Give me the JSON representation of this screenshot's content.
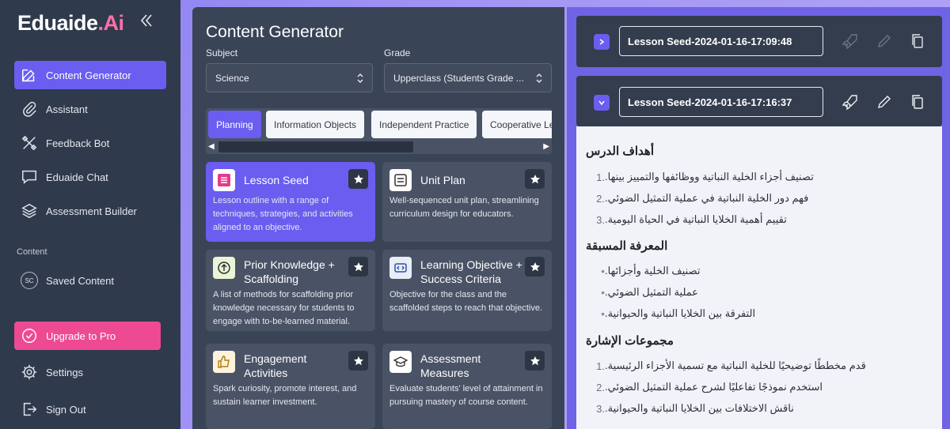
{
  "app": {
    "logo_main": "Eduaide",
    "logo_accent": ".Ai"
  },
  "sidebar": {
    "items": [
      {
        "label": "Content Generator"
      },
      {
        "label": "Assistant"
      },
      {
        "label": "Feedback Bot"
      },
      {
        "label": "Eduaide Chat"
      },
      {
        "label": "Assessment Builder"
      }
    ],
    "section_label": "Content",
    "saved": {
      "badge": "SC",
      "label": "Saved Content"
    },
    "upgrade": "Upgrade to Pro",
    "settings": "Settings",
    "signout": "Sign Out"
  },
  "generator": {
    "title": "Content Generator",
    "subject_label": "Subject",
    "subject_value": "Science",
    "grade_label": "Grade",
    "grade_value": "Upperclass (Students Grade ...",
    "tabs": [
      "Planning",
      "Information Objects",
      "Independent Practice",
      "Cooperative Le"
    ],
    "cards": [
      {
        "title": "Lesson Seed",
        "desc": "Lesson outline with a range of techniques, strategies, and activities aligned to an objective."
      },
      {
        "title": "Unit Plan",
        "desc": "Well-sequenced unit plan, streamlining curriculum design for educators."
      },
      {
        "title": "Prior Knowledge + Scaffolding",
        "desc": "A list of methods for scaffolding prior knowledge necessary for students to engage with to-be-learned material."
      },
      {
        "title": "Learning Objective + Success Criteria",
        "desc": "Objective for the class and the scaffolded steps to reach that objective."
      },
      {
        "title": "Engagement Activities",
        "desc": "Spark curiosity, promote interest, and sustain learner investment."
      },
      {
        "title": "Assessment Measures",
        "desc": "Evaluate students' level of attainment in pursuing mastery of course content."
      }
    ]
  },
  "seeds": [
    {
      "name": "Lesson Seed-2024-01-16-17:09:48",
      "expanded": false
    },
    {
      "name": "Lesson Seed-2024-01-16-17:16:37",
      "expanded": true
    }
  ],
  "content": {
    "sections": [
      {
        "heading": "أهداف الدرس",
        "style": "numbered",
        "items": [
          "تصنيف أجزاء الخلية النباتية ووظائفها والتمييز بينها.",
          "فهم دور الخلية النباتية في عملية التمثيل الضوئي.",
          "تقييم أهمية الخلايا النباتية في الحياة اليومية."
        ]
      },
      {
        "heading": "المعرفة المسبقة",
        "style": "bullet",
        "items": [
          "تصنيف الخلية وأجزائها.",
          "عملية التمثيل الضوئي.",
          "التفرقة بين الخلايا النباتية والحيوانية."
        ]
      },
      {
        "heading": "مجموعات الإشارة",
        "style": "numbered",
        "items": [
          "قدم مخططًا توضيحيًا للخلية النباتية مع تسمية الأجزاء الرئيسية.",
          "استخدم نموذجًا تفاعليًا لشرح عملية التمثيل الضوئي.",
          "ناقش الاختلافات بين الخلايا النباتية والحيوانية."
        ]
      }
    ]
  },
  "colors": {
    "accent": "#6a5df0",
    "sidebar_bg": "#2f3a4c",
    "panel_bg": "#3a4457",
    "upgrade": "#ee4a93"
  }
}
